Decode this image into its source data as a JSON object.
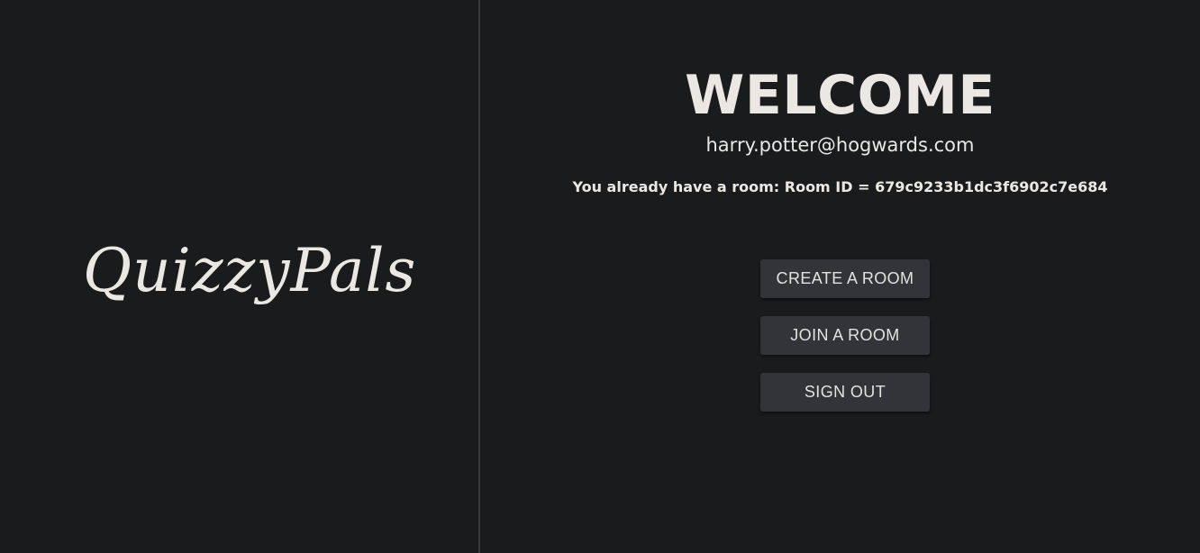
{
  "brand": {
    "logo_text": "QuizzyPals"
  },
  "welcome": {
    "title": "WELCOME",
    "email": "harry.potter@hogwards.com",
    "room_notice": "You already have a room: Room ID = 679c9233b1dc3f6902c7e684"
  },
  "actions": {
    "create_room": "CREATE A ROOM",
    "join_room": "JOIN A ROOM",
    "sign_out": "SIGN OUT"
  },
  "colors": {
    "background": "#1a1b1d",
    "text": "#ebe8e3",
    "button_bg": "#323437",
    "divider": "#3a3b3e"
  }
}
